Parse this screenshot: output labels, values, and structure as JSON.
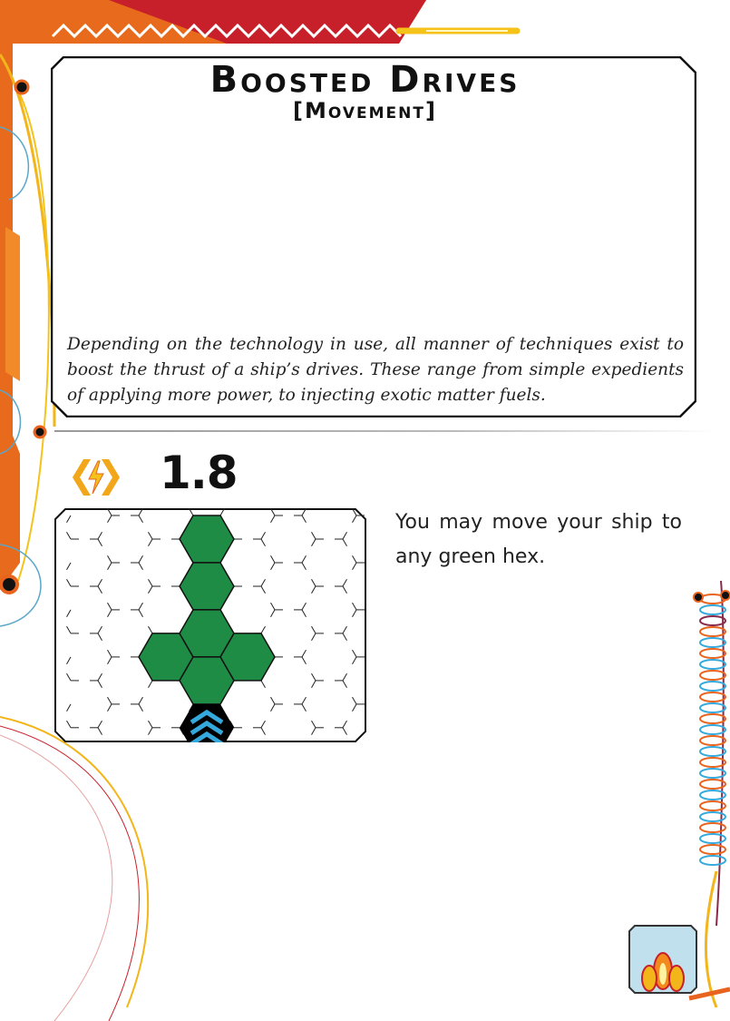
{
  "card": {
    "title": "Boosted Drives",
    "subtitle": "[Movement]",
    "flavor": "Depending on the technology in use, all manner of techniques exist to boost the thrust of a ship’s drives. These range from simple expedients of applying more power, to injecting exotic matter fuels."
  },
  "stats": {
    "value": "1.8",
    "cost_icon": "power-cost-icon"
  },
  "rules": {
    "text": "You may move your ship to any green hex."
  },
  "diagram": {
    "green_hexes": [
      [
        3,
        0
      ],
      [
        3,
        1
      ],
      [
        2,
        2
      ],
      [
        3,
        2
      ],
      [
        4,
        2
      ],
      [
        3,
        3
      ]
    ],
    "ship_hex": [
      3,
      4
    ],
    "ship_icon": "chevron-ship-icon",
    "colors": {
      "green": "#1e8c45",
      "ship_bg": "#000000",
      "ship_chevron": "#35a8dc",
      "grid": "#222222"
    }
  },
  "theme": {
    "accent_orange": "#e8641e",
    "accent_yellow": "#f2b51a",
    "accent_red": "#c8202a"
  }
}
